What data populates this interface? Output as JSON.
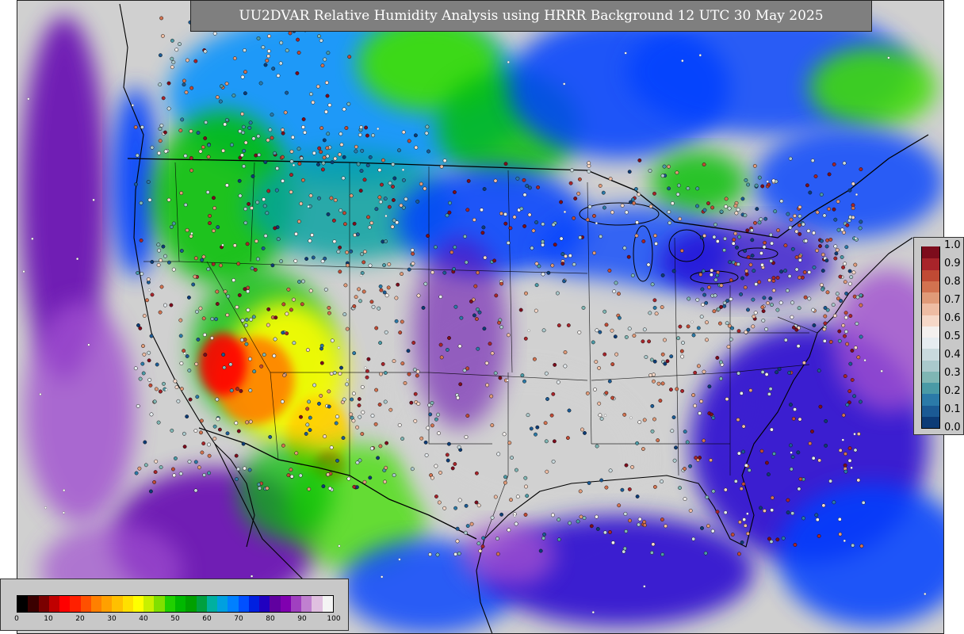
{
  "title": "UU2DVAR Relative Humidity Analysis using HRRR Background 12 UTC 30 May 2025",
  "rh_colorbar": {
    "ticks": [
      "0",
      "10",
      "20",
      "30",
      "40",
      "50",
      "60",
      "70",
      "80",
      "90",
      "100"
    ],
    "colors": [
      "#000000",
      "#3a0000",
      "#7a0000",
      "#c00000",
      "#ff0000",
      "#ff2000",
      "#ff5000",
      "#ff8000",
      "#ffa000",
      "#ffc000",
      "#ffe000",
      "#ffff00",
      "#c8f000",
      "#80e000",
      "#20d000",
      "#00b800",
      "#00a000",
      "#00a040",
      "#00b0a0",
      "#00a0e0",
      "#0080ff",
      "#0050ff",
      "#0020e0",
      "#2000c0",
      "#6000a0",
      "#8000b0",
      "#a040c0",
      "#c080d0",
      "#e0c0e0",
      "#f4f4f4"
    ]
  },
  "obs_colorbar": {
    "ticks": [
      "0.0",
      "0.1",
      "0.2",
      "0.3",
      "0.4",
      "0.5",
      "0.6",
      "0.7",
      "0.8",
      "0.9",
      "1.0"
    ],
    "colors": [
      "#0c3b76",
      "#1b5a94",
      "#2b7aa8",
      "#4a9aa6",
      "#7fb6b4",
      "#aac9cc",
      "#c9dade",
      "#e6ecf0",
      "#f4f0ee",
      "#f6d8c8",
      "#eebca3",
      "#e09a78",
      "#d27250",
      "#c04a34",
      "#a8242a",
      "#7d0c1c"
    ]
  },
  "map": {
    "ocean_color": "#d0d0d0",
    "land_moist_color": "#d2d2d2",
    "dry_colors": [
      "#ff0000",
      "#ff8000",
      "#ffd000",
      "#ffff00"
    ],
    "mid_colors": [
      "#00c000",
      "#40e000",
      "#00a0a0",
      "#0090ff"
    ],
    "wet_colors": [
      "#0040ff",
      "#2000d0",
      "#6000b0",
      "#a050d0",
      "#e0c0e8"
    ]
  }
}
